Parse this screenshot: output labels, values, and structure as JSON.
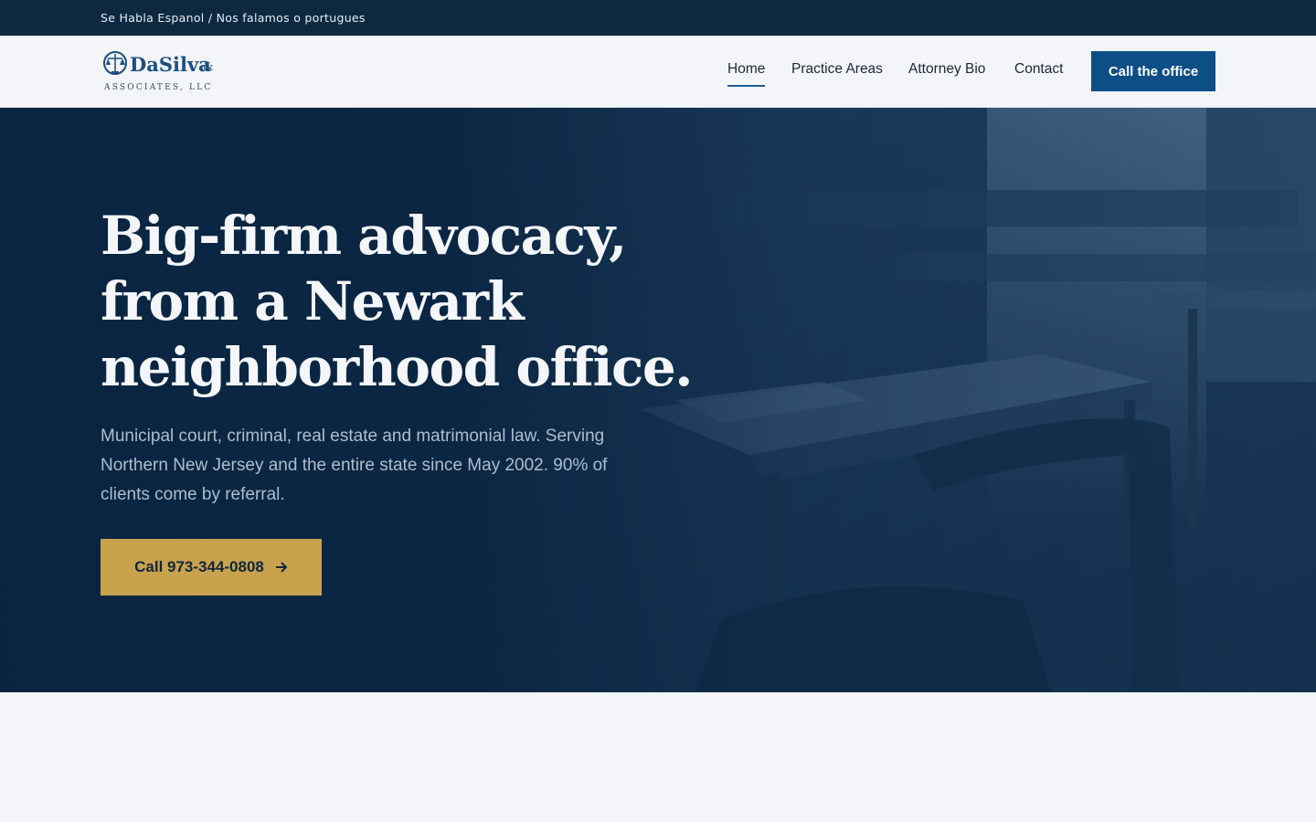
{
  "topbar": {
    "text": "Se Habla Espanol / Nos falamos o portugues"
  },
  "logo": {
    "name": "DaSilva",
    "amp": "&",
    "subtitle": "ASSOCIATES, LLC"
  },
  "nav": {
    "items": [
      {
        "label": "Home"
      },
      {
        "label": "Practice Areas"
      },
      {
        "label": "Attorney Bio"
      },
      {
        "label": "Contact"
      }
    ],
    "cta_label": "Call the office"
  },
  "hero": {
    "title_line1": "Big-firm advocacy,",
    "title_line2": "from a Newark",
    "title_line3": "neighborhood office.",
    "subtitle": "Municipal court, criminal, real estate and matrimonial law. Serving Northern New Jersey and the entire state since May 2002. 90% of clients come by referral.",
    "cta_label": "Call 973-344-0808",
    "cta_icon": "arrow-right-icon"
  },
  "colors": {
    "topbar": "#0e2842",
    "hero_overlay": "#092440",
    "primary": "#0d4e86",
    "accent_gold": "#c9a24e"
  }
}
